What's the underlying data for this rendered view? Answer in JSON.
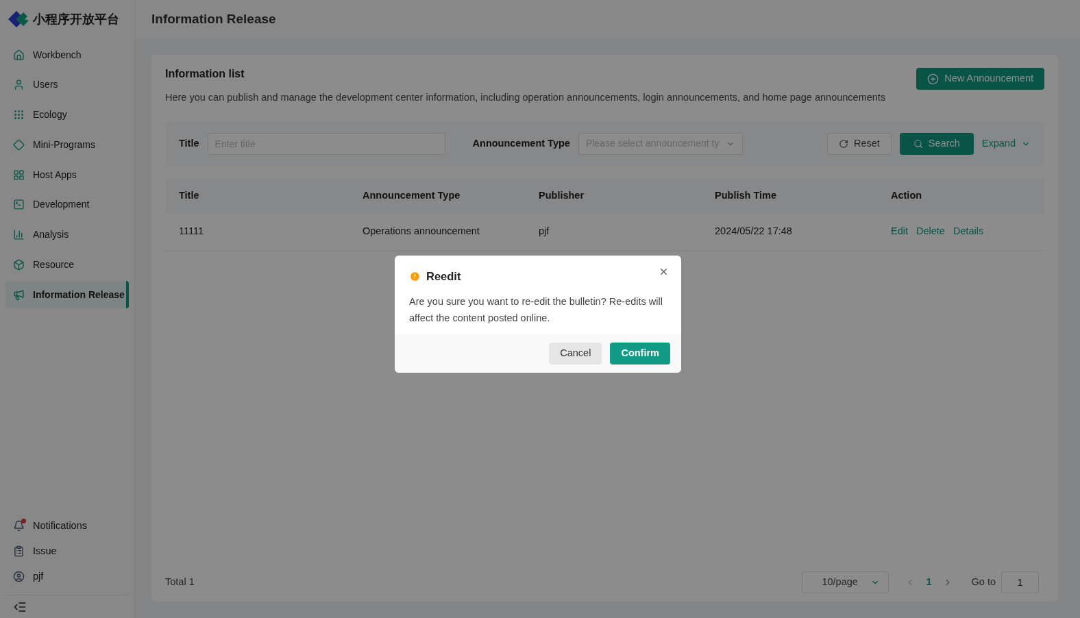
{
  "brand": {
    "name": "小程序开放平台"
  },
  "header": {
    "title": "Information Release"
  },
  "sidebar": {
    "items": [
      {
        "label": "Workbench",
        "selected": false
      },
      {
        "label": "Users",
        "selected": false
      },
      {
        "label": "Ecology",
        "selected": false
      },
      {
        "label": "Mini-Programs",
        "selected": false
      },
      {
        "label": "Host Apps",
        "selected": false
      },
      {
        "label": "Development",
        "selected": false
      },
      {
        "label": "Analysis",
        "selected": false
      },
      {
        "label": "Resource",
        "selected": false
      },
      {
        "label": "Information Release",
        "selected": true
      }
    ],
    "bottom_items": [
      {
        "label": "Notifications",
        "unread": true
      },
      {
        "label": "Issue",
        "unread": false
      },
      {
        "label": "pjf",
        "unread": false
      }
    ]
  },
  "card": {
    "title": "Information list",
    "description": "Here you can publish and manage the development center information, including operation announcements, login announcements, and home page announcements",
    "new_button": "New Announcement"
  },
  "filters": {
    "title_label": "Title",
    "title_placeholder": "Enter title",
    "type_label": "Announcement Type",
    "type_placeholder": "Please select announcement ty",
    "reset": "Reset",
    "search": "Search",
    "expand": "Expand"
  },
  "table": {
    "columns": [
      "Title",
      "Announcement Type",
      "Publisher",
      "Publish Time",
      "Action"
    ],
    "rows": [
      {
        "cells": [
          "11111",
          "Operations announcement",
          "pjf",
          "2024/05/22 17:48"
        ],
        "actions": [
          "Edit",
          "Delete",
          "Details"
        ]
      }
    ]
  },
  "pagination": {
    "total": "Total 1",
    "page_size": "10/page",
    "pages": [
      {
        "label": "1",
        "selected": true
      }
    ],
    "goto_label": "Go to",
    "goto_value": "1"
  },
  "dialog": {
    "title": "Reedit",
    "message": "Are you sure you want to re-edit the bulletin? Re-edits will affect the content posted online.",
    "cancel": "Cancel",
    "confirm": "Confirm"
  }
}
